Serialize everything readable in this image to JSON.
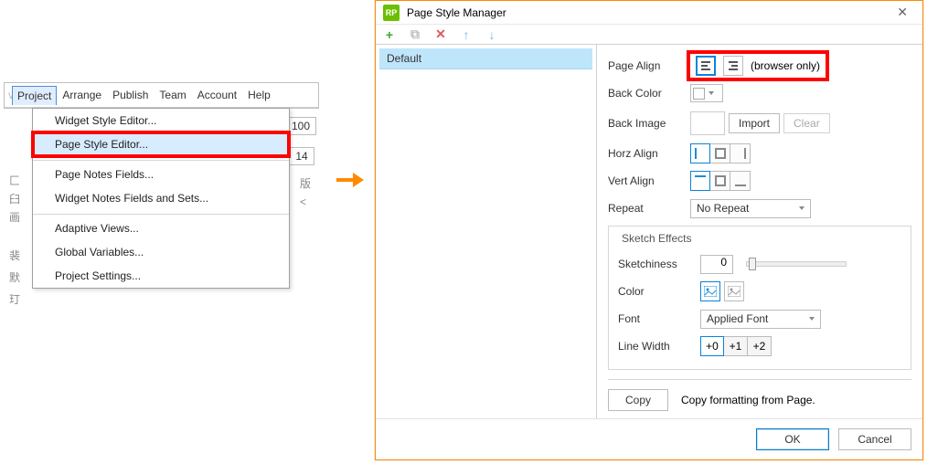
{
  "menubar": {
    "project": "Project",
    "arrange": "Arrange",
    "publish": "Publish",
    "team": "Team",
    "account": "Account",
    "help": "Help"
  },
  "menu": {
    "widget_style": "Widget Style Editor...",
    "page_style": "Page Style Editor...",
    "page_notes": "Page Notes Fields...",
    "widget_notes": "Widget Notes Fields and Sets...",
    "adaptive": "Adaptive Views...",
    "globals": "Global Variables...",
    "settings": "Project Settings..."
  },
  "toolbar_values": {
    "zoom": "100",
    "font_size": "14",
    "cjk_col_a": "匚 臼 画",
    "cjk_col_b": "裴 默 玎",
    "right_chars": "版 <"
  },
  "dialog": {
    "title": "Page Style Manager",
    "app_icon_text": "RP",
    "styles": {
      "default": "Default"
    },
    "labels": {
      "page_align": "Page Align",
      "browser_only": "(browser only)",
      "back_color": "Back Color",
      "back_image": "Back Image",
      "import": "Import",
      "clear": "Clear",
      "horz_align": "Horz Align",
      "vert_align": "Vert Align",
      "repeat": "Repeat",
      "no_repeat": "No Repeat",
      "sketch": "Sketch Effects",
      "sketchiness": "Sketchiness",
      "sketch_val": "0",
      "color": "Color",
      "font": "Font",
      "applied_font": "Applied Font",
      "line_width": "Line Width",
      "lw0": "+0",
      "lw1": "+1",
      "lw2": "+2",
      "copy": "Copy",
      "copy_from": "Copy formatting from Page."
    },
    "buttons": {
      "ok": "OK",
      "cancel": "Cancel"
    }
  }
}
